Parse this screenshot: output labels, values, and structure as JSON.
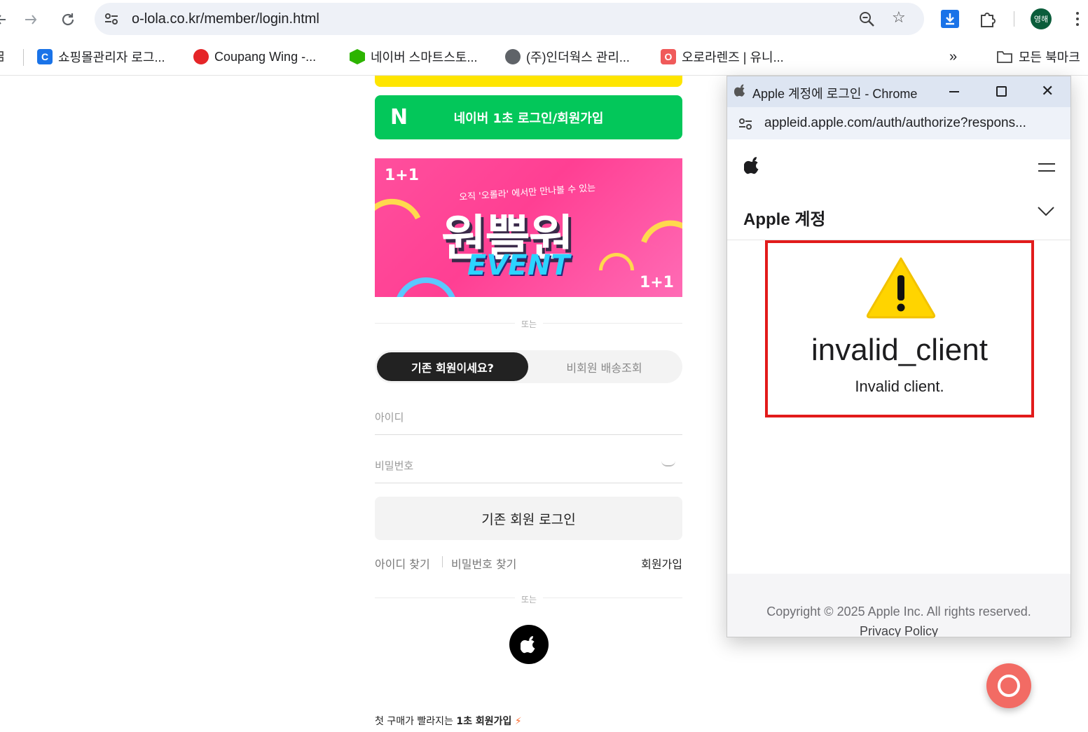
{
  "browser": {
    "url": "o-lola.co.kr/member/login.html",
    "profile_initials": "영해",
    "bookmarks": [
      {
        "label": "쇼핑몰관리자 로그...",
        "icon": "cafe24-c-icon",
        "color": "#1a73e8",
        "glyph": "C"
      },
      {
        "label": "Coupang Wing -...",
        "icon": "coupang-icon",
        "color": "#e52528",
        "glyph": ""
      },
      {
        "label": "네이버 스마트스토...",
        "icon": "naver-smartstore-icon",
        "color": "#2db400",
        "glyph": ""
      },
      {
        "label": "(주)인더웍스 관리...",
        "icon": "globe-icon",
        "color": "#5f6368",
        "glyph": ""
      },
      {
        "label": "오로라렌즈 | 유니...",
        "icon": "olola-icon",
        "color": "#f05a5a",
        "glyph": "O"
      }
    ],
    "all_bookmarks_label": "모든 북마크",
    "overflow_label": "»"
  },
  "page": {
    "naver_button_label": "네이버 1초 로그인/회원가입",
    "naver_letter": "N",
    "banner": {
      "badge_top": "1+1",
      "badge_bottom": "1+1",
      "subtitle": "오직 '오롤라' 에서만 만나볼 수 있는",
      "headline": "원쁠원",
      "event_word": "EVENT"
    },
    "divider_label": "또는",
    "tabs": {
      "active": "기존 회원이세요?",
      "inactive": "비회원 배송조회"
    },
    "id_placeholder": "아이디",
    "password_placeholder": "비밀번호",
    "login_button_label": "기존 회원 로그인",
    "find_id_label": "아이디 찾기",
    "find_password_label": "비밀번호 찾기",
    "signup_label": "회원가입",
    "promo_prefix": "첫 구매가 빨라지는 ",
    "promo_bold": "1초 회원가입",
    "promo_icon": "⚡"
  },
  "popup": {
    "window_title": "Apple 계정에 로그인 - Chrome",
    "url": "appleid.apple.com/auth/authorize?respons...",
    "account_label": "Apple 계정",
    "error_title": "invalid_client",
    "error_message": "Invalid client.",
    "copyright": "Copyright © 2025 Apple Inc. All rights reserved.",
    "privacy_label": "Privacy Policy",
    "highlight_color": "#e21b1b"
  }
}
